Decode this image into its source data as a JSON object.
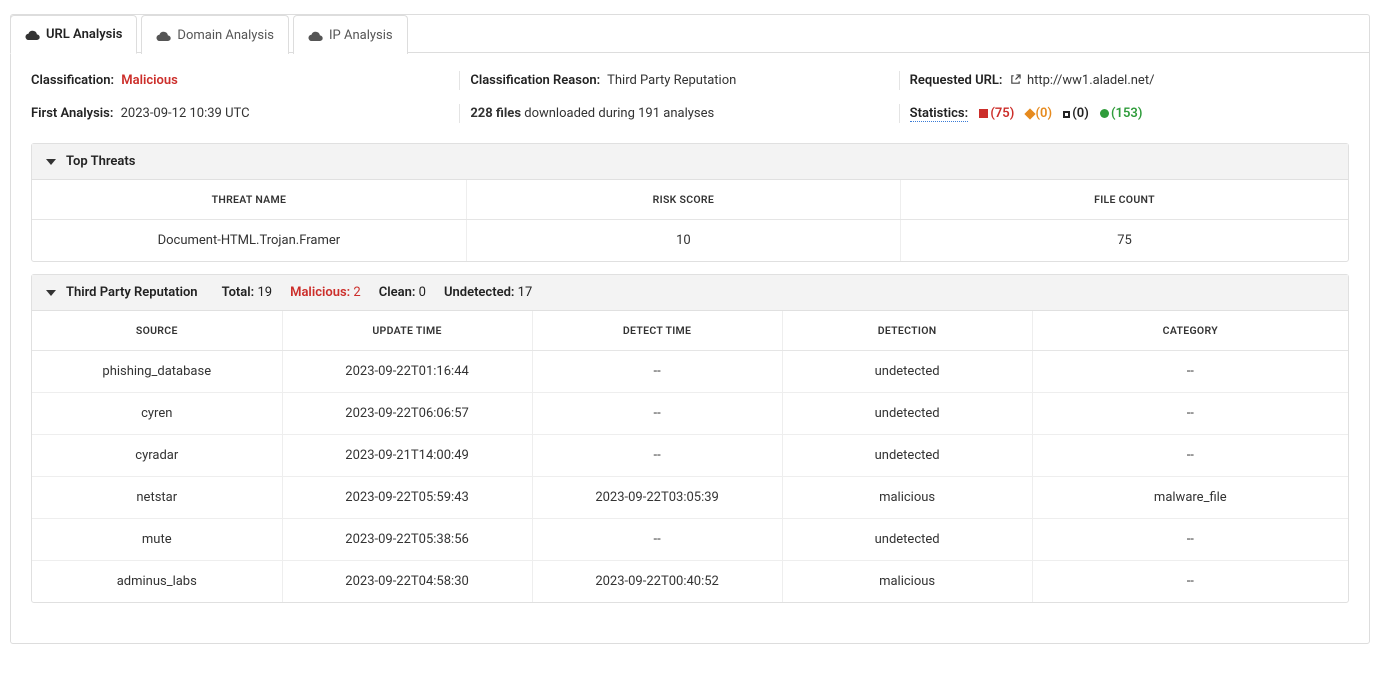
{
  "tabs": {
    "url": "URL Analysis",
    "domain": "Domain Analysis",
    "ip": "IP Analysis"
  },
  "info": {
    "classification_label": "Classification:",
    "classification_value": "Malicious",
    "reason_label": "Classification Reason:",
    "reason_value": "Third Party Reputation",
    "requested_label": "Requested URL:",
    "requested_value": "http://ww1.aladel.net/",
    "first_label": "First Analysis:",
    "first_value": "2023-09-12 10:39 UTC",
    "files_bold": "228 files",
    "files_rest": " downloaded during 191 analyses",
    "stats_label": "Statistics:",
    "stats": {
      "red": "(75)",
      "orange": "(0)",
      "black": "(0)",
      "green": "(153)"
    }
  },
  "threats": {
    "title": "Top Threats",
    "headers": [
      "Threat Name",
      "Risk Score",
      "File Count"
    ],
    "rows": [
      {
        "name": "Document-HTML.Trojan.Framer",
        "risk": "10",
        "count": "75"
      }
    ]
  },
  "reputation": {
    "title": "Third Party Reputation",
    "summary": {
      "total_label": "Total:",
      "total": "19",
      "mal_label": "Malicious:",
      "mal": "2",
      "clean_label": "Clean:",
      "clean": "0",
      "und_label": "Undetected:",
      "und": "17"
    },
    "headers": [
      "Source",
      "Update Time",
      "Detect Time",
      "Detection",
      "Category"
    ],
    "rows": [
      {
        "source": "phishing_database",
        "update": "2023-09-22T01:16:44",
        "detect": "--",
        "detection": "undetected",
        "category": "--"
      },
      {
        "source": "cyren",
        "update": "2023-09-22T06:06:57",
        "detect": "--",
        "detection": "undetected",
        "category": "--"
      },
      {
        "source": "cyradar",
        "update": "2023-09-21T14:00:49",
        "detect": "--",
        "detection": "undetected",
        "category": "--"
      },
      {
        "source": "netstar",
        "update": "2023-09-22T05:59:43",
        "detect": "2023-09-22T03:05:39",
        "detection": "malicious",
        "category": "malware_file"
      },
      {
        "source": "mute",
        "update": "2023-09-22T05:38:56",
        "detect": "--",
        "detection": "undetected",
        "category": "--"
      },
      {
        "source": "adminus_labs",
        "update": "2023-09-22T04:58:30",
        "detect": "2023-09-22T00:40:52",
        "detection": "malicious",
        "category": "--"
      }
    ]
  }
}
